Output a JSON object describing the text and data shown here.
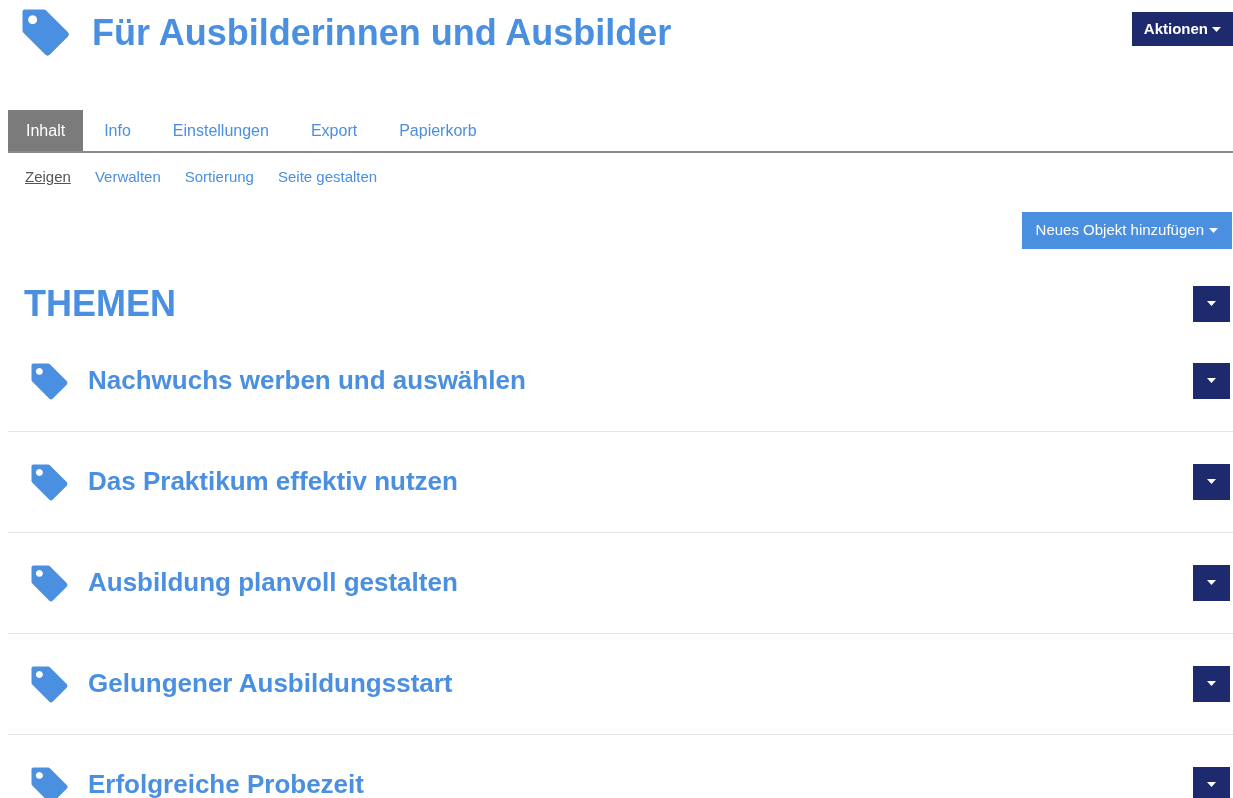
{
  "header": {
    "title": "Für Ausbilderinnen und Ausbilder",
    "actions_button": "Aktionen"
  },
  "tabs": [
    {
      "label": "Inhalt",
      "selected": true
    },
    {
      "label": "Info",
      "selected": false
    },
    {
      "label": "Einstellungen",
      "selected": false
    },
    {
      "label": "Export",
      "selected": false
    },
    {
      "label": "Papierkorb",
      "selected": false
    }
  ],
  "subtabs": [
    {
      "label": "Zeigen",
      "selected": true
    },
    {
      "label": "Verwalten",
      "selected": false
    },
    {
      "label": "Sortierung",
      "selected": false
    },
    {
      "label": "Seite gestalten",
      "selected": false
    }
  ],
  "add_button": "Neues Objekt hinzufügen",
  "section": {
    "title": "THEMEN",
    "items": [
      {
        "title": "Nachwuchs werben und auswählen"
      },
      {
        "title": "Das Praktikum effektiv nutzen"
      },
      {
        "title": "Ausbildung planvoll gestalten"
      },
      {
        "title": "Gelungener Ausbildungsstart"
      },
      {
        "title": "Erfolgreiche Probezeit"
      }
    ]
  }
}
